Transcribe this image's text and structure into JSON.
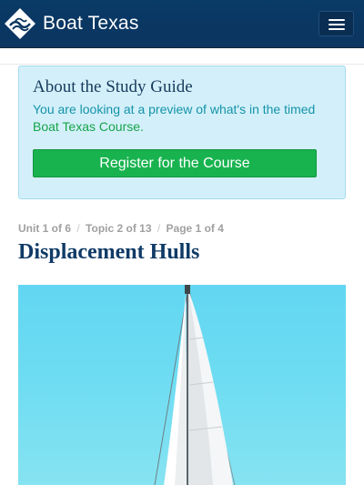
{
  "header": {
    "brand": "Boat Texas",
    "logo_icon": "diamond-wave-logo",
    "menu_icon": "hamburger-menu-icon",
    "background": "#0b3560"
  },
  "study_guide": {
    "title": "About the Study Guide",
    "text": "You are looking at a preview of what's in the timed",
    "link_text": "Boat Texas Course.",
    "button_label": "Register for the Course",
    "accent": "#18b34f"
  },
  "breadcrumb": {
    "unit": "Unit 1 of 6",
    "topic": "Topic 2 of 13",
    "page": "Page 1 of 4",
    "separator": "/"
  },
  "page": {
    "title": "Displacement Hulls",
    "hero_image": "sailboat-photo"
  }
}
